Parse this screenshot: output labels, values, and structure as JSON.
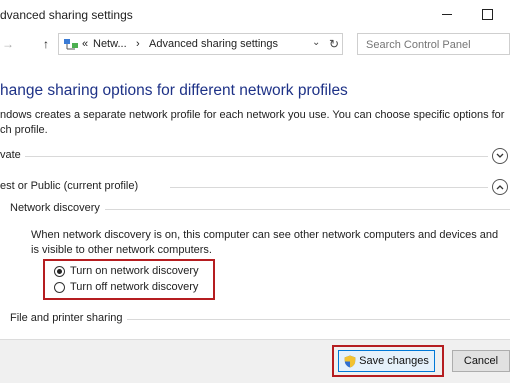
{
  "window": {
    "title": "Advanced sharing settings",
    "title_visible": "dvanced sharing settings"
  },
  "address": {
    "crumbs": [
      "«",
      "Netw...",
      "›",
      "Advanced sharing settings"
    ],
    "search_placeholder": "Search Control Panel"
  },
  "content": {
    "heading": "hange sharing options for different network profiles",
    "description": "ndows creates a separate network profile for each network you use. You can choose specific options for ch profile.",
    "profiles": [
      {
        "label": "vate",
        "state": "collapsed"
      },
      {
        "label": "est or Public (current profile)",
        "state": "expanded"
      }
    ],
    "network_discovery": {
      "title": "Network discovery",
      "description": "When network discovery is on, this computer can see other network computers and devices and is visible to other network computers.",
      "options": [
        {
          "label": "Turn on network discovery",
          "selected": true
        },
        {
          "label": "Turn off network discovery",
          "selected": false
        }
      ]
    },
    "file_printer_sharing": {
      "title": "File and printer sharing"
    }
  },
  "footer": {
    "save_label": "Save changes",
    "cancel_label": "Cancel"
  },
  "colors": {
    "heading": "#1e3287",
    "highlight_box": "#b51d20",
    "footer_bg": "#f0f0f0",
    "primary_button_border": "#0078d7"
  }
}
